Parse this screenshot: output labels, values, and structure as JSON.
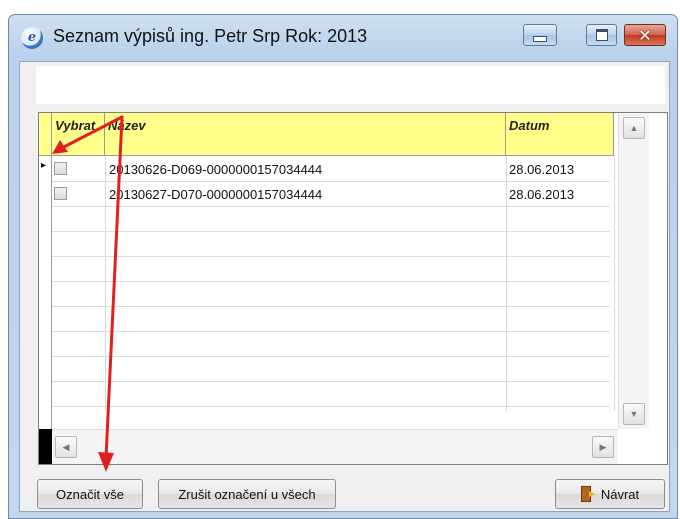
{
  "window": {
    "title": "Seznam výpisů  ing. Petr Srp  Rok: 2013",
    "icon": "ie-e-icon",
    "close_glyph": "✕"
  },
  "grid": {
    "columns": [
      "Vybrat",
      "Název",
      "Datum"
    ],
    "rows": [
      {
        "checked": false,
        "nazev": "20130626-D069-0000000157034444",
        "datum": "28.06.2013"
      },
      {
        "checked": false,
        "nazev": "20130627-D070-0000000157034444",
        "datum": "28.06.2013"
      }
    ],
    "current_row_marker": "▸",
    "scroll_up": "▲",
    "scroll_down": "▼",
    "scroll_left": "◀",
    "scroll_right": "▶"
  },
  "buttons": {
    "select_all": "Označit vše",
    "deselect_all": "Zrušit označení u všech",
    "back": "Návrat"
  },
  "colors": {
    "header_bg": "#ffff8a",
    "annotation_arrow": "#e02020"
  }
}
